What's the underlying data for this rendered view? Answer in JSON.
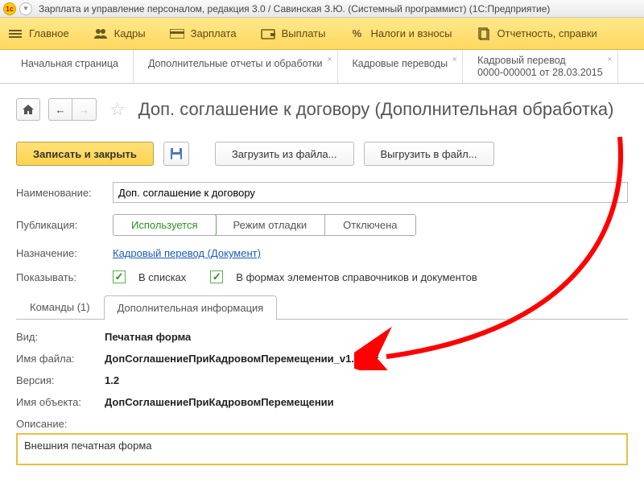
{
  "titlebar": {
    "text": "Зарплата и управление персоналом, редакция 3.0 / Савинская З.Ю. (Системный программист)  (1С:Предприятие)"
  },
  "menu": {
    "main": "Главное",
    "hr": "Кадры",
    "salary": "Зарплата",
    "payments": "Выплаты",
    "taxes": "Налоги и взносы",
    "reports": "Отчетность, справки"
  },
  "tabs": {
    "start": "Начальная страница",
    "reports_proc": "Дополнительные отчеты и обработки",
    "transfers": "Кадровые переводы",
    "transfer_doc_l1": "Кадровый перевод",
    "transfer_doc_l2": "0000-000001 от 28.03.2015"
  },
  "page": {
    "title": "Доп. соглашение к договору (Дополнительная обработка)"
  },
  "toolbar": {
    "save_close": "Записать и закрыть",
    "load": "Загрузить из файла...",
    "export": "Выгрузить в файл..."
  },
  "fields": {
    "name_label": "Наименование:",
    "name_value": "Доп. соглашение к договору",
    "pub_label": "Публикация:",
    "pub_used": "Используется",
    "pub_debug": "Режим отладки",
    "pub_off": "Отключена",
    "purpose_label": "Назначение:",
    "purpose_link": "Кадровый перевод (Документ)",
    "show_label": "Показывать:",
    "show_lists": "В списках",
    "show_forms": "В формах элементов справочников и документов"
  },
  "inner_tabs": {
    "commands": "Команды (1)",
    "info": "Дополнительная информация"
  },
  "info": {
    "type_label": "Вид:",
    "type_val": "Печатная форма",
    "file_label": "Имя файла:",
    "file_val": "ДопСоглашениеПриКадровомПеремещении_v1.2.epf",
    "ver_label": "Версия:",
    "ver_val": "1.2",
    "obj_label": "Имя объекта:",
    "obj_val": "ДопСоглашениеПриКадровомПеремещении",
    "desc_label": "Описание:",
    "desc_val": "Внешния печатная форма"
  }
}
